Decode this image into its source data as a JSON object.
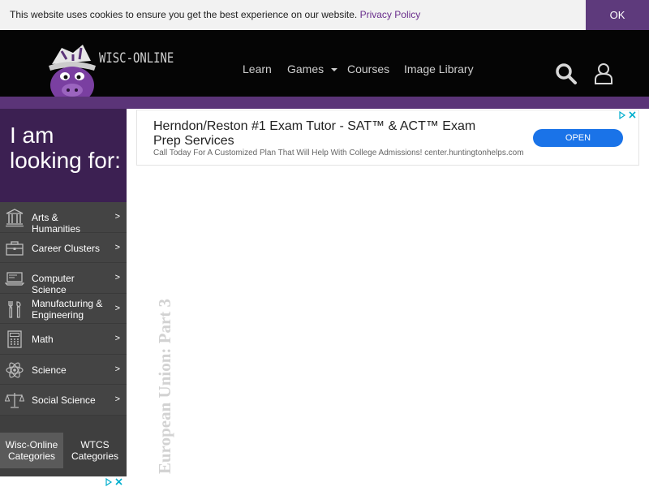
{
  "cookie": {
    "message": "This website uses cookies to ensure you get the best experience on our website.",
    "link": "Privacy Policy",
    "ok": "OK"
  },
  "header": {
    "logo_text": "WISC-ONLINE",
    "nav": [
      {
        "label": "Learn"
      },
      {
        "label": "Games",
        "dropdown": true
      },
      {
        "label": "Courses"
      },
      {
        "label": "Image Library"
      }
    ],
    "icons": [
      "search-icon",
      "user-icon"
    ]
  },
  "sidebar": {
    "hero": "I am looking for:",
    "items": [
      {
        "label": "Arts & Humanities",
        "icon": "columns-icon"
      },
      {
        "label": "Career Clusters",
        "icon": "briefcase-icon"
      },
      {
        "label": "Computer Science",
        "icon": "laptop-icon"
      },
      {
        "label": "Manufacturing & Engineering",
        "icon": "tools-icon"
      },
      {
        "label": "Math",
        "icon": "calculator-icon"
      },
      {
        "label": "Science",
        "icon": "atom-icon"
      },
      {
        "label": "Social Science",
        "icon": "scales-icon"
      }
    ],
    "arrow": ">",
    "tabs": [
      {
        "label": "Wisc-Online Categories",
        "active": true
      },
      {
        "label": "WTCS Categories",
        "active": false
      }
    ]
  },
  "ad": {
    "title": "Herndon/Reston #1 Exam Tutor - SAT™ & ACT™ Exam Prep Services",
    "subtitle": "Call Today For A Customized Plan That Will Help With College Admissions! center.huntingtonhelps.com",
    "button": "OPEN",
    "close": "✕"
  },
  "page": {
    "title": "European Union: Part 3"
  },
  "colors": {
    "purple_dark": "#3c2052",
    "purple_band": "#5b3478",
    "ok_button": "#5e3a7c",
    "link": "#6a2f8c",
    "ad_button": "#1a73e8"
  }
}
